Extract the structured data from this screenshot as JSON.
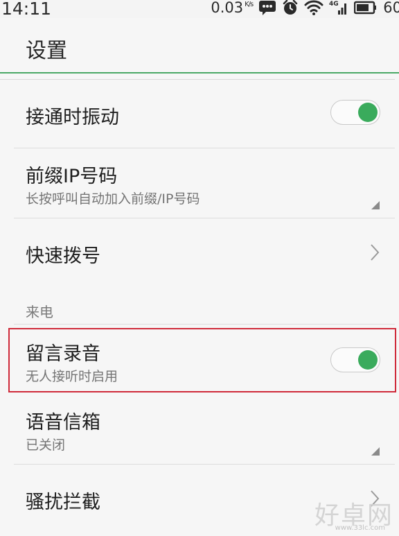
{
  "status_bar": {
    "time": "14:11",
    "speed_value": "0.03",
    "speed_unit": "K/s",
    "battery_text": "60",
    "icons": [
      "message-icon",
      "alarm-icon",
      "wifi-icon",
      "signal-4g-icon",
      "battery-icon"
    ]
  },
  "header": {
    "title": "设置"
  },
  "settings": [
    {
      "title": "接通时振动",
      "control": "toggle",
      "on": true
    },
    {
      "title": "前缀IP号码",
      "subtitle": "长按呼叫自动加入前缀/IP号码",
      "control": "dropdown"
    },
    {
      "title": "快速拨号",
      "control": "chevron"
    }
  ],
  "section_incoming": {
    "label": "来电"
  },
  "incoming_settings": [
    {
      "title": "留言录音",
      "subtitle": "无人接听时启用",
      "control": "toggle",
      "on": true
    },
    {
      "title": "语音信箱",
      "subtitle": "已关闭",
      "control": "dropdown"
    },
    {
      "title": "骚扰拦截",
      "control": "chevron"
    }
  ],
  "watermark": {
    "main": "好卓网",
    "sub": "www.33lc.com"
  },
  "colors": {
    "accent": "#3aab5c",
    "highlight": "#cf2a3a",
    "background": "#f6f6f6"
  }
}
